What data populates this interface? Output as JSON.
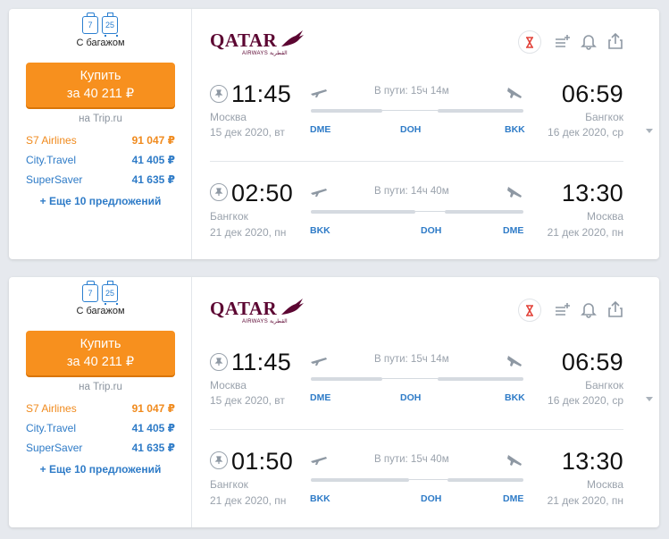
{
  "cards": [
    {
      "baggage": {
        "hand_kg": "7",
        "bag_kg": "25",
        "label": "С багажом"
      },
      "buy": {
        "line1": "Купить",
        "line2": "за 40 211 ₽"
      },
      "source": "на Trip.ru",
      "offers": [
        {
          "name": "S7 Airlines",
          "price": "91 047 ₽"
        },
        {
          "name": "City.Travel",
          "price": "41 405 ₽"
        },
        {
          "name": "SuperSaver",
          "price": "41 635 ₽"
        }
      ],
      "more": "+ Еще 10 предложений",
      "airline": {
        "word": "QATAR",
        "sub": "AIRWAYS القطرية"
      },
      "segments": [
        {
          "dep_time": "11:45",
          "dep_city": "Москва",
          "dep_date": "15 дек 2020, вт",
          "arr_time": "06:59",
          "arr_city": "Бангкок",
          "arr_date": "16 дек 2020, ср",
          "duration": "В пути: 15ч 14м",
          "codes": [
            "DME",
            "DOH",
            "BKK"
          ]
        },
        {
          "dep_time": "02:50",
          "dep_city": "Бангкок",
          "dep_date": "21 дек 2020, пн",
          "arr_time": "13:30",
          "arr_city": "Москва",
          "arr_date": "21 дек 2020, пн",
          "duration": "В пути: 14ч 40м",
          "codes": [
            "BKK",
            "DOH",
            "DME"
          ]
        }
      ]
    },
    {
      "baggage": {
        "hand_kg": "7",
        "bag_kg": "25",
        "label": "С багажом"
      },
      "buy": {
        "line1": "Купить",
        "line2": "за 40 211 ₽"
      },
      "source": "на Trip.ru",
      "offers": [
        {
          "name": "S7 Airlines",
          "price": "91 047 ₽"
        },
        {
          "name": "City.Travel",
          "price": "41 405 ₽"
        },
        {
          "name": "SuperSaver",
          "price": "41 635 ₽"
        }
      ],
      "more": "+ Еще 10 предложений",
      "airline": {
        "word": "QATAR",
        "sub": "AIRWAYS القطرية"
      },
      "segments": [
        {
          "dep_time": "11:45",
          "dep_city": "Москва",
          "dep_date": "15 дек 2020, вт",
          "arr_time": "06:59",
          "arr_city": "Бангкок",
          "arr_date": "16 дек 2020, ср",
          "duration": "В пути: 15ч 14м",
          "codes": [
            "DME",
            "DOH",
            "BKK"
          ]
        },
        {
          "dep_time": "01:50",
          "dep_city": "Бангкок",
          "dep_date": "21 дек 2020, пн",
          "arr_time": "13:30",
          "arr_city": "Москва",
          "arr_date": "21 дек 2020, пн",
          "duration": "В пути: 15ч 40м",
          "codes": [
            "BKK",
            "DOH",
            "DME"
          ]
        }
      ]
    }
  ],
  "colors": {
    "buy_button": "#f7901e",
    "best_offer": "#f08a1d",
    "link": "#2e7bc7",
    "brand": "#5c0632"
  }
}
